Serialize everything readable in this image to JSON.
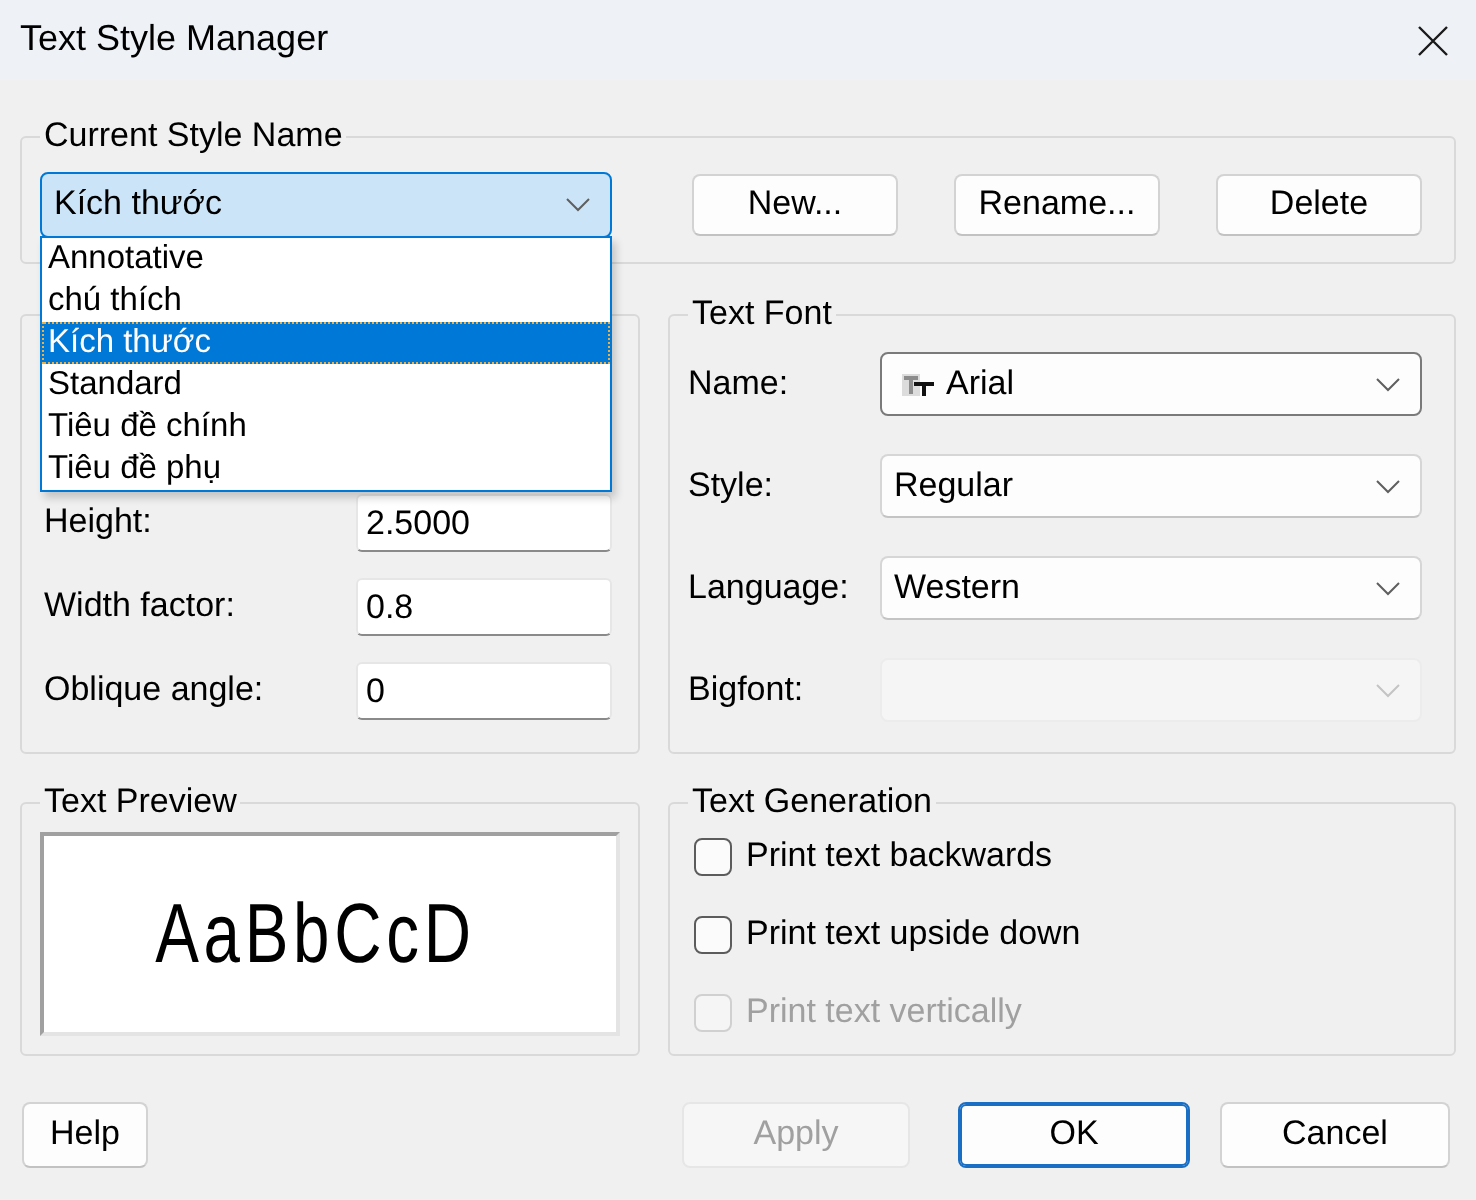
{
  "window": {
    "title": "Text Style Manager"
  },
  "current_style": {
    "title": "Current Style Name",
    "value": "Kích thước",
    "expanded": true,
    "options": [
      {
        "label": "Annotative",
        "selected": false
      },
      {
        "label": "chú thích",
        "selected": false
      },
      {
        "label": "Kích thước",
        "selected": true
      },
      {
        "label": "Standard",
        "selected": false
      },
      {
        "label": "Tiêu đề chính",
        "selected": false
      },
      {
        "label": "Tiêu đề phụ",
        "selected": false
      }
    ],
    "buttons": [
      "New...",
      "Rename...",
      "Delete"
    ]
  },
  "left_group": {
    "fields": [
      {
        "label": "Height:",
        "value": "2.5000"
      },
      {
        "label": "Width factor:",
        "value": "0.8"
      },
      {
        "label": "Oblique angle:",
        "value": "0"
      }
    ]
  },
  "text_font": {
    "title": "Text Font",
    "fields": [
      {
        "label": "Name:",
        "kind": "font",
        "value": "Arial",
        "disabled": false
      },
      {
        "label": "Style:",
        "kind": "plain",
        "value": "Regular",
        "disabled": false
      },
      {
        "label": "Language:",
        "kind": "plain",
        "value": "Western",
        "disabled": false
      },
      {
        "label": "Bigfont:",
        "kind": "plain",
        "disabled": true
      }
    ]
  },
  "text_preview": {
    "title": "Text Preview",
    "sample": "AaBbCcD"
  },
  "text_generation": {
    "title": "Text Generation",
    "options": [
      {
        "label": "Print text backwards",
        "checked": false,
        "disabled": false
      },
      {
        "label": "Print text upside down",
        "checked": false,
        "disabled": false
      },
      {
        "label": "Print text vertically",
        "checked": false,
        "disabled": true
      }
    ]
  },
  "help_button": {
    "label": "Help"
  },
  "buttons": [
    {
      "label": "Apply",
      "disabled": true,
      "default": false
    },
    {
      "label": "OK",
      "disabled": false,
      "default": true
    },
    {
      "label": "Cancel",
      "disabled": false,
      "default": false
    }
  ]
}
